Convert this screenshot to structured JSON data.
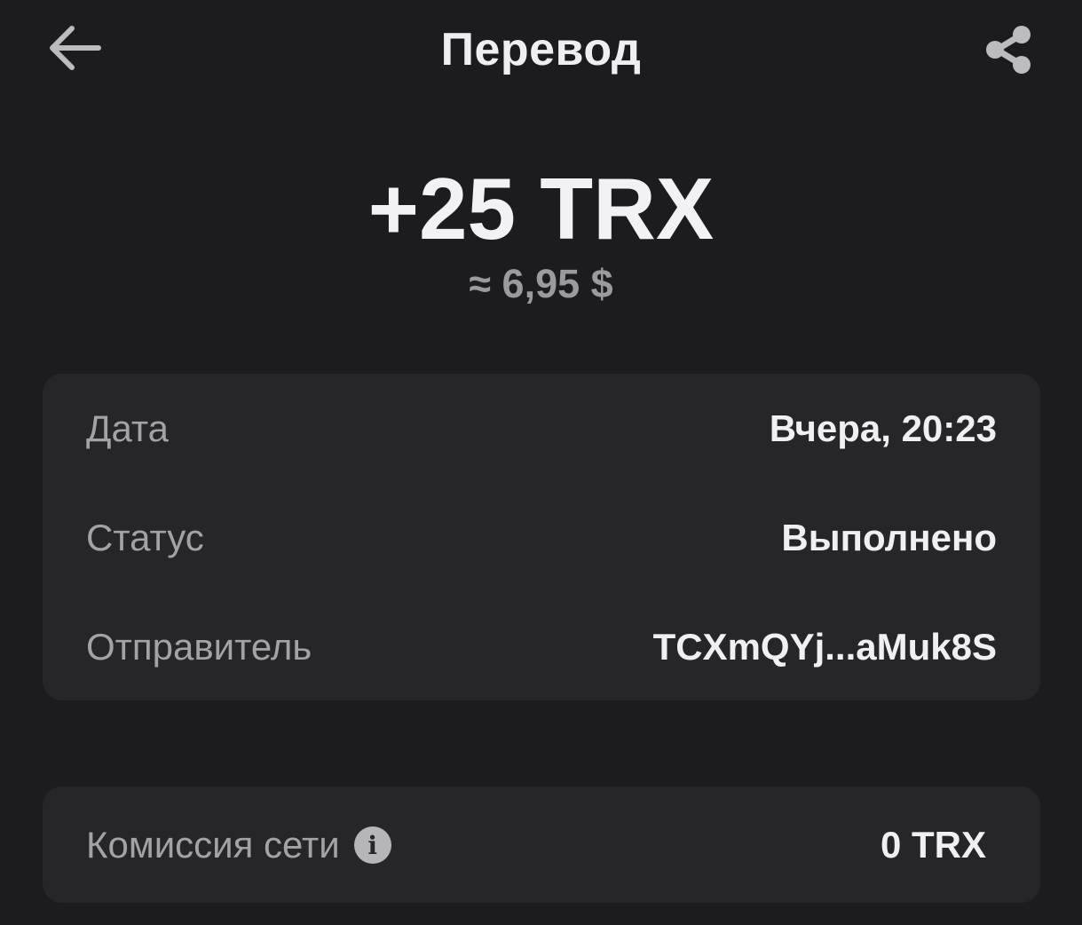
{
  "header": {
    "title": "Перевод",
    "back_icon": "arrow-left-icon",
    "share_icon": "share-icon"
  },
  "transaction": {
    "amount": "+25 TRX",
    "fiat_approx": "≈ 6,95 $"
  },
  "details": {
    "rows": [
      {
        "label": "Дата",
        "value": "Вчера, 20:23"
      },
      {
        "label": "Статус",
        "value": "Выполнено"
      },
      {
        "label": "Отправитель",
        "value": "TCXmQYj...aMuk8S"
      }
    ]
  },
  "fee": {
    "label": "Комиссия сети",
    "value": "0 TRX",
    "info_icon": "info-icon"
  },
  "colors": {
    "background": "#1c1c1e",
    "card": "#262628",
    "primary_text": "#f0f0f2",
    "secondary_text": "#a2a2a7"
  }
}
